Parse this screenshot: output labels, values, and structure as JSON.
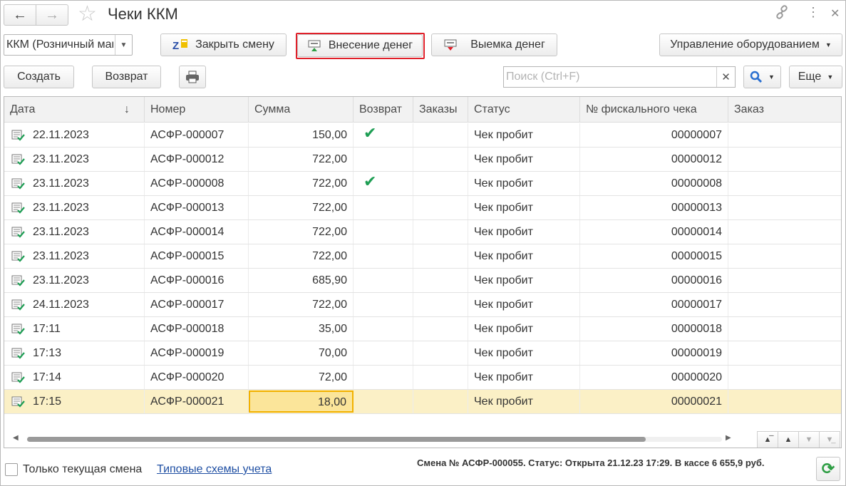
{
  "window": {
    "title": "Чеки ККМ",
    "back_icon": "arrow-left-icon",
    "forward_icon": "arrow-right-icon",
    "favorite_icon": "star-icon",
    "link_icon": "link-icon",
    "menu_icon": "more-vertical-icon",
    "close_icon": "close-icon"
  },
  "toolbar1": {
    "kkm_select_value": "ККМ (Розничный магазин)",
    "close_shift": "Закрыть смену",
    "cash_in": "Внесение денег",
    "cash_out": "Выемка денег",
    "equipment": "Управление оборудованием"
  },
  "toolbar2": {
    "create": "Создать",
    "return": "Возврат",
    "print_icon": "printer-icon",
    "search_placeholder": "Поиск (Ctrl+F)",
    "more": "Еще"
  },
  "table": {
    "columns": [
      "Дата",
      "Номер",
      "Сумма",
      "Возврат",
      "Заказы",
      "Статус",
      "№ фискального чека",
      "Заказ"
    ],
    "sort_indicator": "↓",
    "rows": [
      {
        "date": "22.11.2023",
        "number": "АСФР-000007",
        "sum": "150,00",
        "return": true,
        "status": "Чек пробит",
        "fiscal": "00000007"
      },
      {
        "date": "23.11.2023",
        "number": "АСФР-000012",
        "sum": "722,00",
        "return": false,
        "status": "Чек пробит",
        "fiscal": "00000012"
      },
      {
        "date": "23.11.2023",
        "number": "АСФР-000008",
        "sum": "722,00",
        "return": true,
        "status": "Чек пробит",
        "fiscal": "00000008"
      },
      {
        "date": "23.11.2023",
        "number": "АСФР-000013",
        "sum": "722,00",
        "return": false,
        "status": "Чек пробит",
        "fiscal": "00000013"
      },
      {
        "date": "23.11.2023",
        "number": "АСФР-000014",
        "sum": "722,00",
        "return": false,
        "status": "Чек пробит",
        "fiscal": "00000014"
      },
      {
        "date": "23.11.2023",
        "number": "АСФР-000015",
        "sum": "722,00",
        "return": false,
        "status": "Чек пробит",
        "fiscal": "00000015"
      },
      {
        "date": "23.11.2023",
        "number": "АСФР-000016",
        "sum": "685,90",
        "return": false,
        "status": "Чек пробит",
        "fiscal": "00000016"
      },
      {
        "date": "24.11.2023",
        "number": "АСФР-000017",
        "sum": "722,00",
        "return": false,
        "status": "Чек пробит",
        "fiscal": "00000017"
      },
      {
        "date": "17:11",
        "number": "АСФР-000018",
        "sum": "35,00",
        "return": false,
        "status": "Чек пробит",
        "fiscal": "00000018"
      },
      {
        "date": "17:13",
        "number": "АСФР-000019",
        "sum": "70,00",
        "return": false,
        "status": "Чек пробит",
        "fiscal": "00000019"
      },
      {
        "date": "17:14",
        "number": "АСФР-000020",
        "sum": "72,00",
        "return": false,
        "status": "Чек пробит",
        "fiscal": "00000020"
      },
      {
        "date": "17:15",
        "number": "АСФР-000021",
        "sum": "18,00",
        "return": false,
        "status": "Чек пробит",
        "fiscal": "00000021",
        "selected": true
      }
    ]
  },
  "footer": {
    "only_current_shift": "Только текущая смена",
    "accounting_link": "Типовые схемы учета",
    "status": "Смена № АСФР-000055. Статус: Открыта 21.12.23 17:29. В кассе 6 655,9 руб.",
    "refresh_icon": "refresh-icon"
  },
  "colors": {
    "highlight_border": "#e0202a",
    "selected_row": "#fbf0c6",
    "focused_cell": "#fbe59a",
    "check_green": "#1e9e54",
    "link_blue": "#1f4fa3"
  }
}
